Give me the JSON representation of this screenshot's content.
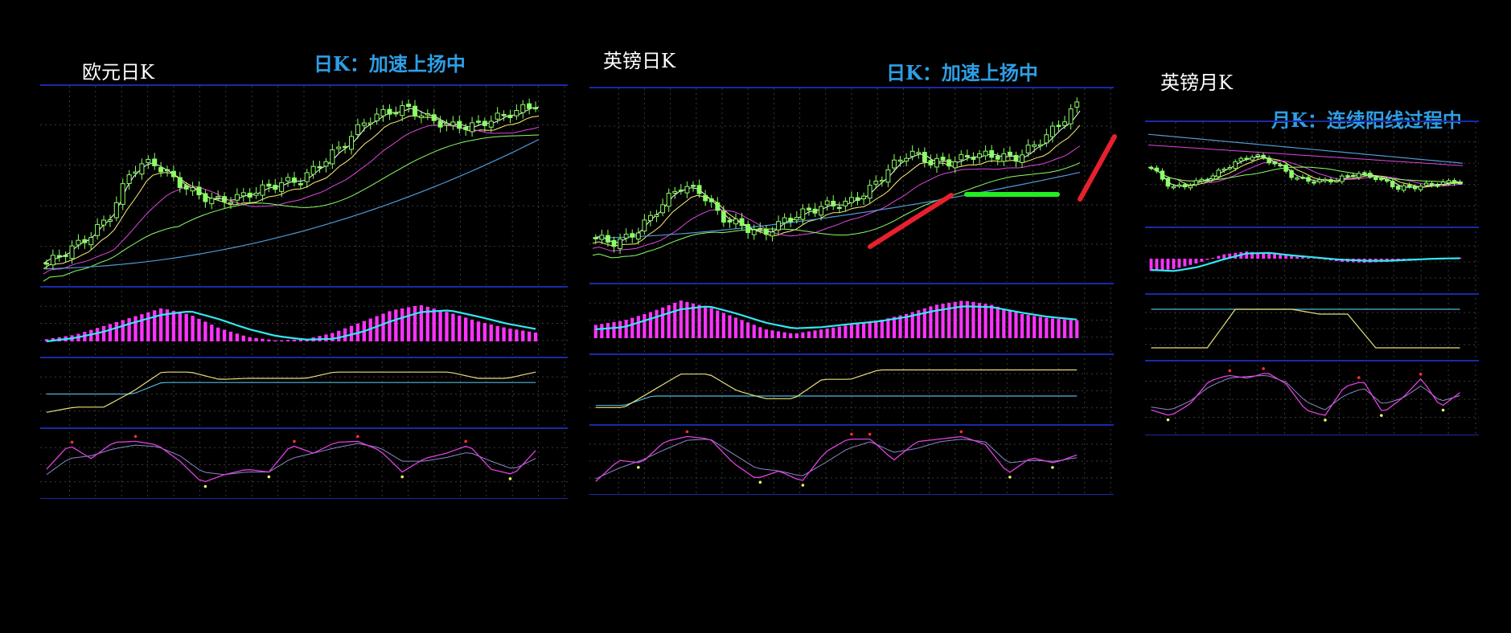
{
  "colors": {
    "background": "#000000",
    "grid": "#3a3a3a",
    "separator": "#1a2aa8",
    "candle": "#8cff66",
    "ma5": "#ffffff",
    "ma10": "#fff27a",
    "ma20": "#e046e0",
    "ma60": "#8cff66",
    "ma120": "#4f9ad6",
    "macd_bar": "#ff33ff",
    "macd_line": "#33e6f0",
    "ind_upper": "#e8e07a",
    "ind_lower": "#4fb8e0",
    "kdj_k": "#e040e0",
    "kdj_d": "#8a8ac8",
    "dot_red": "#ff3030",
    "dot_yellow": "#f0f060",
    "title": "#ffffff",
    "note": "#2e9fe6",
    "trend_red": "#e8202e",
    "trend_green": "#22ee22"
  },
  "panels": [
    {
      "title": "欧元日K",
      "note": "日K：加速上扬中",
      "chart_data": {
        "type": "line",
        "candles_count": 78,
        "price_path": [
          0.05,
          0.12,
          0.2,
          0.32,
          0.58,
          0.62,
          0.52,
          0.44,
          0.4,
          0.42,
          0.46,
          0.5,
          0.52,
          0.62,
          0.72,
          0.85,
          0.9,
          0.92,
          0.86,
          0.82,
          0.82,
          0.86,
          0.9,
          0.94
        ],
        "macd": [
          0.05,
          0.15,
          0.35,
          0.55,
          0.75,
          0.6,
          0.3,
          0.1,
          0.02,
          0.05,
          0.2,
          0.45,
          0.7,
          0.82,
          0.65,
          0.45,
          0.3,
          0.2
        ],
        "macd_line": [
          0.0,
          0.08,
          0.22,
          0.42,
          0.6,
          0.68,
          0.5,
          0.28,
          0.12,
          0.04,
          0.06,
          0.22,
          0.46,
          0.66,
          0.7,
          0.56,
          0.4,
          0.28
        ],
        "ind_upper": [
          0.15,
          0.25,
          0.25,
          0.55,
          0.92,
          0.92,
          0.78,
          0.8,
          0.8,
          0.8,
          0.92,
          0.92,
          0.92,
          0.92,
          0.92,
          0.8,
          0.8,
          0.92
        ],
        "ind_lower": [
          0.5,
          0.5,
          0.5,
          0.5,
          0.72,
          0.72,
          0.72,
          0.72,
          0.72,
          0.72,
          0.72,
          0.72,
          0.72,
          0.72,
          0.72,
          0.72,
          0.72,
          0.72
        ],
        "kdj_k": [
          0.4,
          0.85,
          0.6,
          0.9,
          0.92,
          0.85,
          0.55,
          0.15,
          0.3,
          0.4,
          0.35,
          0.85,
          0.7,
          0.9,
          0.92,
          0.75,
          0.35,
          0.6,
          0.7,
          0.85,
          0.4,
          0.3,
          0.75
        ],
        "kdj_d": [
          0.3,
          0.6,
          0.65,
          0.78,
          0.85,
          0.82,
          0.65,
          0.35,
          0.3,
          0.35,
          0.35,
          0.6,
          0.7,
          0.8,
          0.88,
          0.8,
          0.55,
          0.55,
          0.62,
          0.72,
          0.55,
          0.4,
          0.6
        ]
      }
    },
    {
      "title": "英镑日K",
      "note": "日K：加速上扬中",
      "chart_data": {
        "type": "line",
        "candles_count": 80,
        "price_path": [
          0.18,
          0.15,
          0.22,
          0.35,
          0.48,
          0.45,
          0.3,
          0.25,
          0.2,
          0.28,
          0.33,
          0.37,
          0.38,
          0.45,
          0.58,
          0.68,
          0.62,
          0.62,
          0.66,
          0.66,
          0.64,
          0.72,
          0.82,
          0.95
        ],
        "macd": [
          0.3,
          0.4,
          0.6,
          0.85,
          0.7,
          0.45,
          0.2,
          0.1,
          0.2,
          0.3,
          0.4,
          0.55,
          0.75,
          0.85,
          0.75,
          0.55,
          0.45,
          0.4
        ],
        "macd_line": [
          0.2,
          0.25,
          0.45,
          0.65,
          0.72,
          0.55,
          0.35,
          0.22,
          0.25,
          0.32,
          0.38,
          0.48,
          0.62,
          0.72,
          0.7,
          0.58,
          0.48,
          0.42
        ],
        "ind_upper": [
          0.18,
          0.18,
          0.5,
          0.82,
          0.82,
          0.5,
          0.35,
          0.35,
          0.72,
          0.72,
          0.9,
          0.9,
          0.9,
          0.9,
          0.9,
          0.9,
          0.9,
          0.9
        ],
        "ind_lower": [
          0.22,
          0.22,
          0.4,
          0.4,
          0.4,
          0.4,
          0.4,
          0.4,
          0.4,
          0.4,
          0.4,
          0.4,
          0.4,
          0.4,
          0.4,
          0.4,
          0.4,
          0.4
        ],
        "kdj_k": [
          0.1,
          0.5,
          0.45,
          0.85,
          0.95,
          0.9,
          0.45,
          0.15,
          0.3,
          0.1,
          0.65,
          0.9,
          0.9,
          0.5,
          0.85,
          0.9,
          0.95,
          0.8,
          0.25,
          0.55,
          0.45,
          0.6
        ],
        "kdj_d": [
          0.15,
          0.35,
          0.5,
          0.7,
          0.88,
          0.9,
          0.62,
          0.35,
          0.3,
          0.2,
          0.45,
          0.72,
          0.85,
          0.65,
          0.72,
          0.85,
          0.9,
          0.85,
          0.45,
          0.5,
          0.48,
          0.55
        ]
      }
    },
    {
      "title": "英镑月K",
      "note": "月K：连续阳线过程中",
      "chart_data": {
        "type": "line",
        "candles_count": 56,
        "price_path": [
          0.55,
          0.3,
          0.35,
          0.45,
          0.6,
          0.7,
          0.6,
          0.42,
          0.38,
          0.4,
          0.48,
          0.42,
          0.3,
          0.32,
          0.36,
          0.38
        ],
        "macd": [
          -0.6,
          -0.5,
          -0.2,
          0.2,
          0.35,
          0.25,
          0.1,
          0.0,
          -0.15,
          -0.2,
          -0.15,
          -0.1,
          0.0,
          0.05
        ],
        "macd_line": [
          -0.55,
          -0.6,
          -0.4,
          -0.05,
          0.25,
          0.28,
          0.15,
          0.05,
          -0.05,
          -0.1,
          -0.1,
          -0.05,
          0.0,
          0.02
        ],
        "ind_upper": [
          0.1,
          0.1,
          0.1,
          0.9,
          0.9,
          0.9,
          0.8,
          0.8,
          0.1,
          0.1,
          0.1,
          0.1
        ],
        "ind_lower": [
          0.9,
          0.9,
          0.9,
          0.9,
          0.9,
          0.9,
          0.9,
          0.9,
          0.9,
          0.9,
          0.9,
          0.9
        ],
        "kdj_k": [
          0.3,
          0.2,
          0.4,
          0.8,
          0.9,
          0.85,
          0.95,
          0.75,
          0.3,
          0.2,
          0.7,
          0.8,
          0.25,
          0.5,
          0.85,
          0.35,
          0.6
        ],
        "kdj_d": [
          0.35,
          0.3,
          0.45,
          0.7,
          0.85,
          0.88,
          0.9,
          0.78,
          0.45,
          0.3,
          0.55,
          0.68,
          0.4,
          0.5,
          0.72,
          0.45,
          0.55
        ]
      }
    }
  ]
}
